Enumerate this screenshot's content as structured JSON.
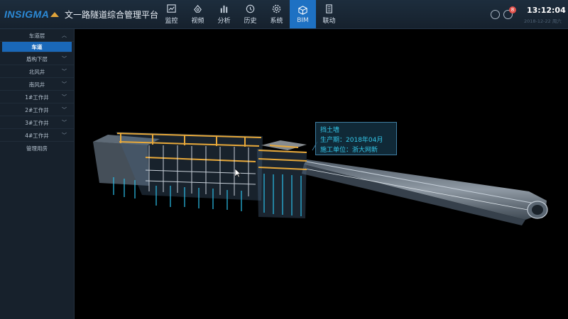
{
  "header": {
    "logo": "INSIGMA",
    "title": "文一路隧道综合管理平台",
    "nav": [
      {
        "label": "监控",
        "icon": "monitor-chart-icon"
      },
      {
        "label": "视频",
        "icon": "video-icon"
      },
      {
        "label": "分析",
        "icon": "bar-chart-icon"
      },
      {
        "label": "历史",
        "icon": "history-clock-icon"
      },
      {
        "label": "系统",
        "icon": "gear-icon"
      },
      {
        "label": "BIM",
        "icon": "cube-icon",
        "active": true
      },
      {
        "label": "联动",
        "icon": "building-icon"
      }
    ],
    "notification_count": "8",
    "time": "13:12:04",
    "date": "2018-12-22  周六"
  },
  "sidebar": {
    "items": [
      {
        "label": "车道层",
        "chevron": "up"
      },
      {
        "label": "车道",
        "selected": true
      },
      {
        "label": "盾构下层",
        "chevron": "down"
      },
      {
        "label": "北风井",
        "chevron": "down"
      },
      {
        "label": "南风井",
        "chevron": "down"
      },
      {
        "label": "1#工作井",
        "chevron": "down"
      },
      {
        "label": "2#工作井",
        "chevron": "down"
      },
      {
        "label": "3#工作井",
        "chevron": "down"
      },
      {
        "label": "4#工作井",
        "chevron": "down"
      },
      {
        "label": "管理用房"
      }
    ]
  },
  "tooltip": {
    "name": "挡土墙",
    "production_label": "生产期：",
    "production_value": "2018年04月",
    "builder_label": "施工单位：",
    "builder_value": "浙大网新"
  },
  "colors": {
    "accent": "#1e71c3",
    "tooltip_text": "#34c8ea",
    "badge": "#e2504a",
    "steel": "#e8a93a"
  }
}
